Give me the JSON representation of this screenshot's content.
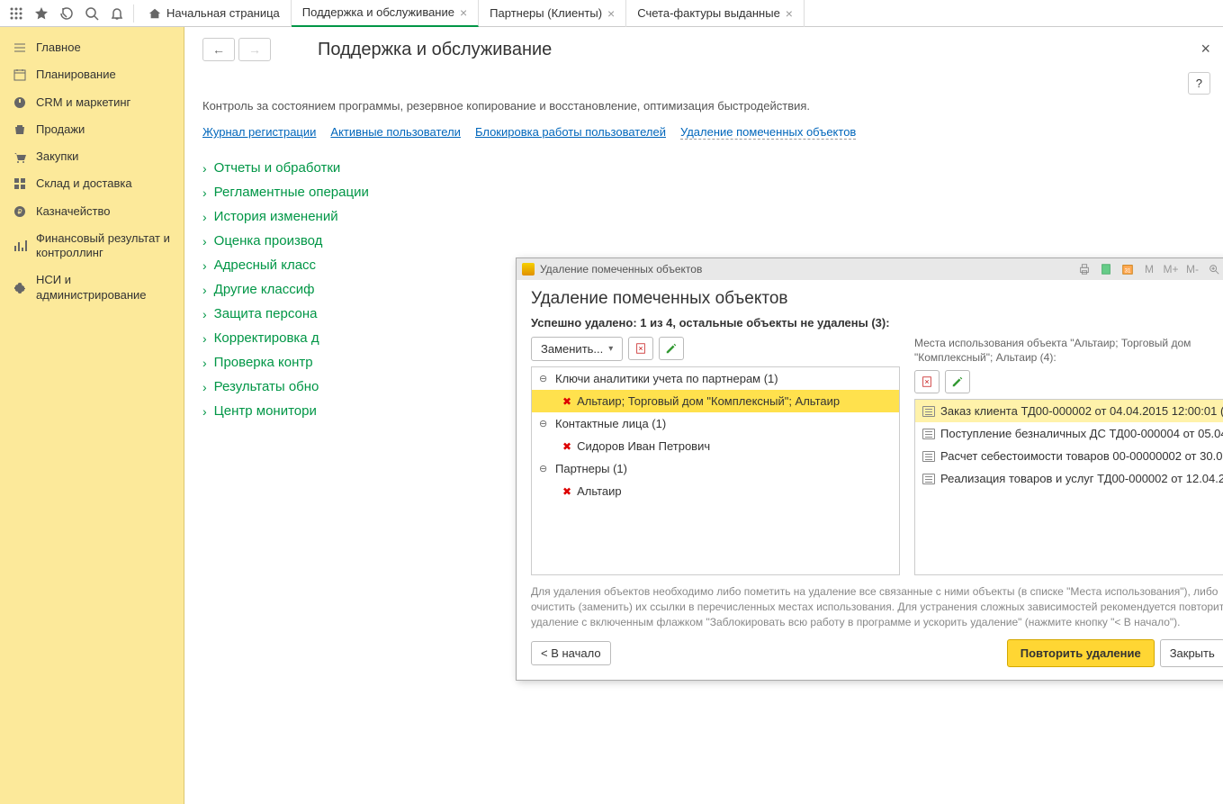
{
  "tabs": {
    "home": "Начальная страница",
    "items": [
      {
        "label": "Поддержка и обслуживание",
        "active": true
      },
      {
        "label": "Партнеры (Клиенты)",
        "active": false
      },
      {
        "label": "Счета-фактуры выданные",
        "active": false
      }
    ]
  },
  "sidebar": {
    "items": [
      "Главное",
      "Планирование",
      "CRM и маркетинг",
      "Продажи",
      "Закупки",
      "Склад и доставка",
      "Казначейство",
      "Финансовый результат и контроллинг",
      "НСИ и администрирование"
    ]
  },
  "page": {
    "title": "Поддержка и обслуживание",
    "description": "Контроль за состоянием программы, резервное копирование и восстановление, оптимизация быстродействия.",
    "links": [
      "Журнал регистрации",
      "Активные пользователи",
      "Блокировка работы пользователей",
      "Удаление помеченных объектов"
    ],
    "sections": [
      "Отчеты и обработки",
      "Регламентные операции",
      "История изменений",
      "Оценка производ",
      "Адресный класс",
      "Другие классиф",
      "Защита персона",
      "Корректировка д",
      "Проверка контр",
      "Результаты обно",
      "Центр монитори"
    ],
    "help_label": "?"
  },
  "modal": {
    "titlebar": "Удаление помеченных объектов",
    "heading": "Удаление помеченных объектов",
    "status": "Успешно удалено: 1 из 4, остальные объекты не удалены (3):",
    "replace_btn": "Заменить...",
    "usage_caption": "Места использования объекта \"Альтаир; Торговый дом \"Комплексный\"; Альтаир (4):",
    "left_tree": {
      "group1": {
        "label": "Ключи аналитики учета по партнерам (1)",
        "item": "Альтаир; Торговый дом \"Комплексный\"; Альтаир"
      },
      "group2": {
        "label": "Контактные лица  (1)",
        "item": "Сидоров Иван Петрович"
      },
      "group3": {
        "label": "Партнеры  (1)",
        "item": "Альтаир"
      }
    },
    "right_list": [
      "Заказ клиента ТД00-000002 от 04.04.2015 12:00:01 (...",
      "Поступление безналичных ДС ТД00-000004 от 05.04...",
      "Расчет себестоимости товаров 00-00000002 от 30.0...",
      "Реализация товаров и услуг ТД00-000002 от 12.04.2..."
    ],
    "footer_text": "Для удаления объектов необходимо либо пометить на удаление все связанные с ними объекты (в списке \"Места использования\"), либо очистить (заменить) их ссылки в перечисленных местах использования. Для устранения сложных зависимостей рекомендуется повторить удаление с включенным флажком \"Заблокировать всю работу в программе и ускорить удаление\" (нажмите кнопку \"< В начало\").",
    "back_btn": "< В начало",
    "repeat_btn": "Повторить удаление",
    "close_btn": "Закрыть",
    "help_btn": "?",
    "tb": {
      "m": "M",
      "mplus": "M+",
      "mminus": "M-"
    }
  }
}
